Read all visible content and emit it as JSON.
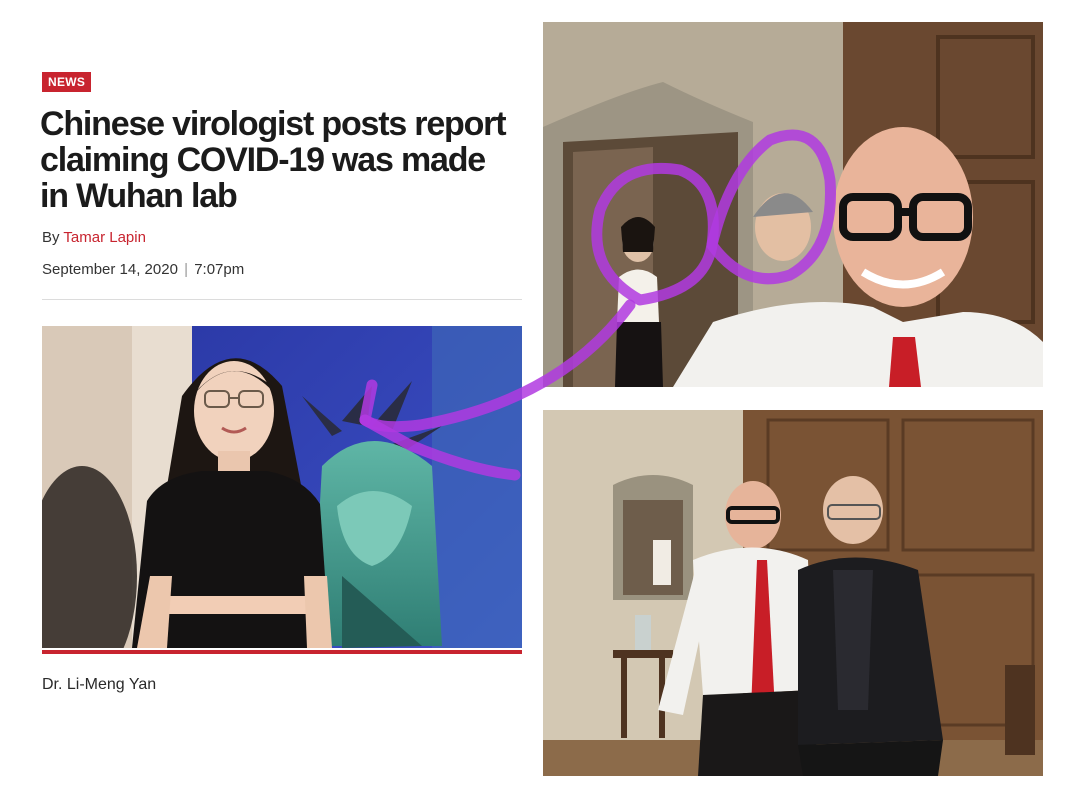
{
  "article": {
    "badge": "NEWS",
    "headline": "Chinese virologist posts report claiming COVID-19 was made in Wuhan lab",
    "byline_prefix": "By ",
    "author": "Tamar Lapin",
    "date": "September 14, 2020",
    "separator": "|",
    "time": "7:07pm",
    "caption": "Dr. Li-Meng Yan"
  },
  "colors": {
    "brand_red": "#c8242f",
    "annotation_purple": "#b03ae0"
  }
}
